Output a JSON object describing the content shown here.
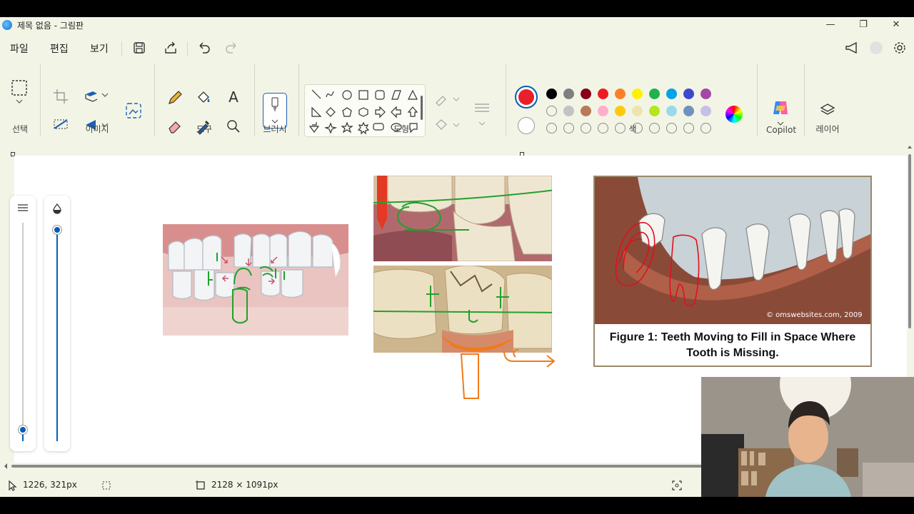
{
  "window": {
    "title": "제목 없음 - 그림판",
    "minimize": "—",
    "maximize": "❐",
    "close": "✕"
  },
  "menu": {
    "file": "파일",
    "edit": "편집",
    "view": "보기"
  },
  "ribbon": {
    "groups": {
      "select": "선택",
      "image": "이미지",
      "tools": "도구",
      "brushes": "브러시",
      "shapes": "도형",
      "colors": "색",
      "copilot": "Copilot",
      "layers": "레이어"
    },
    "text_tool": "A",
    "selected_color": "#e8202a",
    "palette_row1": [
      "#000000",
      "#7f7f7f",
      "#880015",
      "#ed1c24",
      "#ff7f27",
      "#fff200",
      "#22b14c",
      "#00a2e8",
      "#3f48cc",
      "#a349a4"
    ],
    "palette_row2": [
      "#ffffff",
      "#c3c3c3",
      "#b97a57",
      "#ffaec9",
      "#ffc90e",
      "#efe4b0",
      "#b5e61d",
      "#99d9ea",
      "#7092be",
      "#c8bfe7"
    ]
  },
  "canvas": {
    "figure_caption_line1": "Figure 1: Teeth Moving to Fill in Space Where",
    "figure_caption_line2": "Tooth is Missing.",
    "watermark": "© omswebsites.com, 2009"
  },
  "status": {
    "cursor_position": "1226, 321px",
    "canvas_size": "2128 × 1091px"
  },
  "colors": {
    "accent": "#005fb8",
    "window_bg": "#f2f5e6",
    "annotation_green": "#2ca02c",
    "annotation_red": "#e0101e",
    "annotation_orange": "#f07a1a"
  }
}
